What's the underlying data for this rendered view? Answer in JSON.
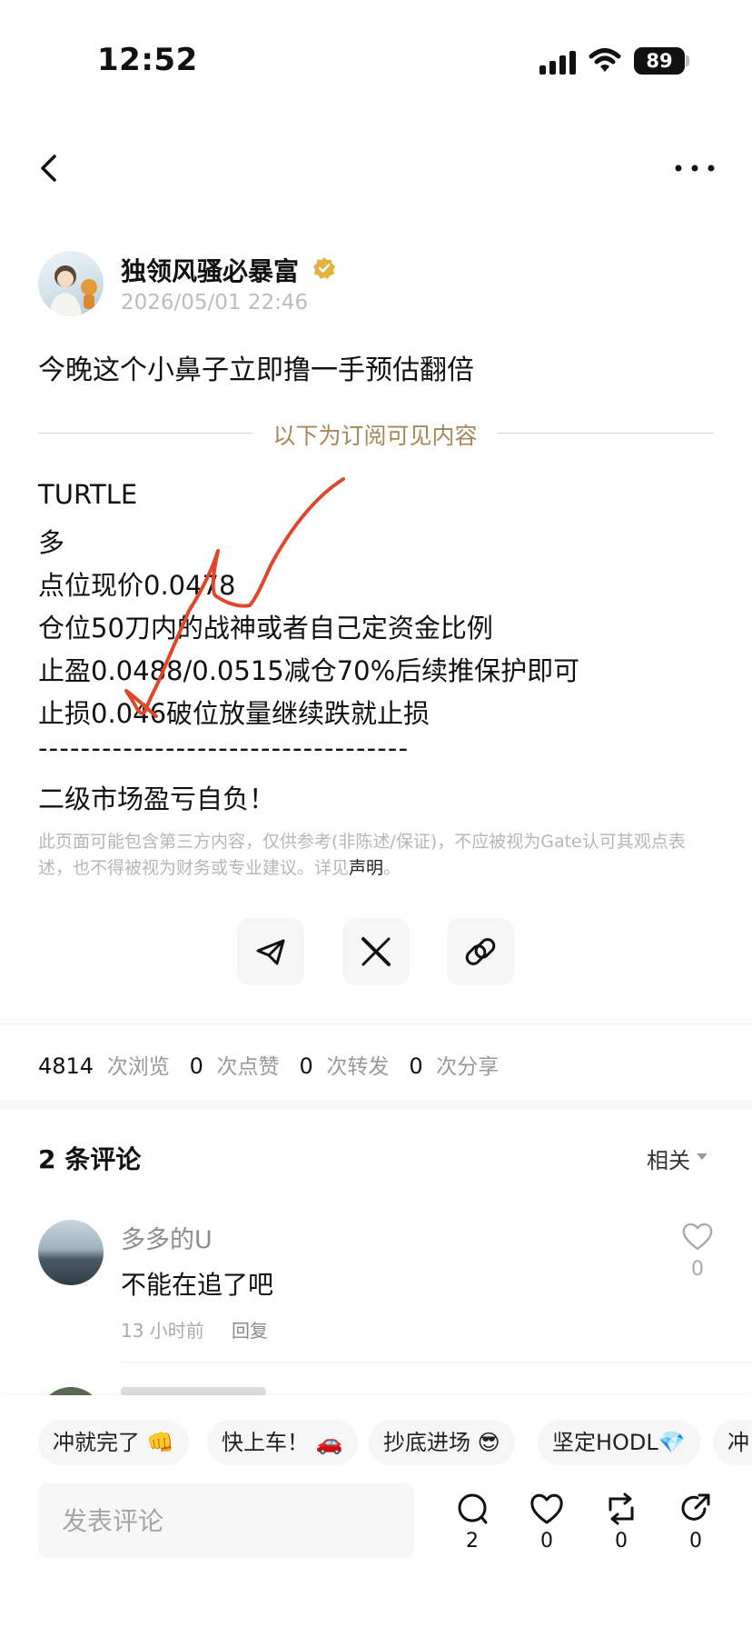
{
  "status_bar": {
    "time": "12:52",
    "battery": "89"
  },
  "author": {
    "name": "独领风骚必暴富",
    "time": "2026/05/01 22:46"
  },
  "post": {
    "title": "今晚这个小鼻子立即撸一手预估翻倍",
    "divider_text": "以下为订阅可见内容",
    "lines": [
      "TURTLE",
      "多",
      "点位现价0.0478",
      "仓位50刀内的战神或者自己定资金比例",
      "止盈0.0488/0.0515减仓70%后续推保护即可",
      "止损0.046破位放量继续跌就止损",
      "-----------------------------------",
      "二级市场盈亏自负！"
    ],
    "disclaimer": "此页面可能包含第三方内容，仅供参考(非陈述/保证)，不应被视为Gate认可其观点表述，也不得被视为财务或专业建议。详见",
    "disclaimer_link": "声明",
    "disclaimer_end": "。",
    "annotation_color": "#e0462a"
  },
  "share": {
    "icons": [
      "telegram-icon",
      "x-icon",
      "link-icon"
    ]
  },
  "stats": {
    "views": "4814",
    "views_label": "次浏览",
    "likes": "0",
    "likes_label": "次点赞",
    "reposts": "0",
    "reposts_label": "次转发",
    "shares": "0",
    "shares_label": "次分享"
  },
  "comments": {
    "title": "2 条评论",
    "sort": "相关",
    "items": [
      {
        "user": "多多的U",
        "text": "不能在追了吧",
        "time": "13 小时前",
        "reply": "回复",
        "likes": "0"
      }
    ]
  },
  "quick_replies": [
    "冲就完了 👊",
    "快上车！ 🚗",
    "抄底进场 😎",
    "坚定HODL💎",
    "冲"
  ],
  "comment_bar": {
    "placeholder": "发表评论",
    "comment_count": "2",
    "like_count": "0",
    "repost_count": "0",
    "share_count": "0"
  },
  "colors": {
    "accent_gold": "#a5875a",
    "verified": "#e3b23c"
  }
}
